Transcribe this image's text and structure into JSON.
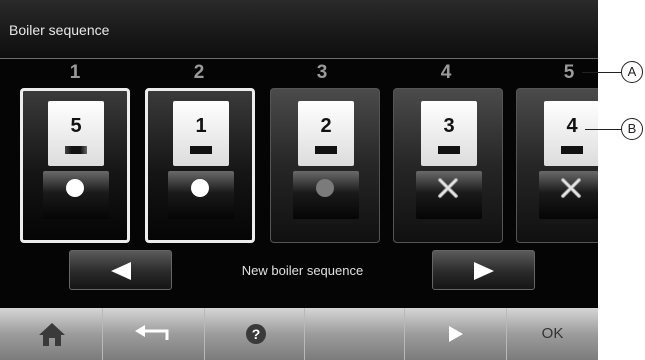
{
  "header": {
    "title": "Boiler sequence"
  },
  "positions": [
    "1",
    "2",
    "3",
    "4",
    "5"
  ],
  "tiles": [
    {
      "value": "5",
      "state": "active",
      "indicator": "dot-white",
      "bar": "blur"
    },
    {
      "value": "1",
      "state": "active",
      "indicator": "dot-white",
      "bar": "solid"
    },
    {
      "value": "2",
      "state": "idle",
      "indicator": "dot-gray",
      "bar": "solid"
    },
    {
      "value": "3",
      "state": "idle",
      "indicator": "x-mark",
      "bar": "solid"
    },
    {
      "value": "4",
      "state": "idle",
      "indicator": "x-mark",
      "bar": "solid"
    }
  ],
  "navigation": {
    "center_label": "New boiler sequence",
    "prev_icon": "arrow-left-icon",
    "next_icon": "arrow-right-icon"
  },
  "footer": {
    "home_icon": "home-icon",
    "back_icon": "back-arrow-icon",
    "help_icon": "help-icon",
    "next_icon": "play-right-icon",
    "ok_label": "OK"
  },
  "annotations": {
    "a": "A",
    "b": "B"
  },
  "colors": {
    "background": "#050505",
    "active_border": "#ededed",
    "footer": "#9c9c9c"
  }
}
